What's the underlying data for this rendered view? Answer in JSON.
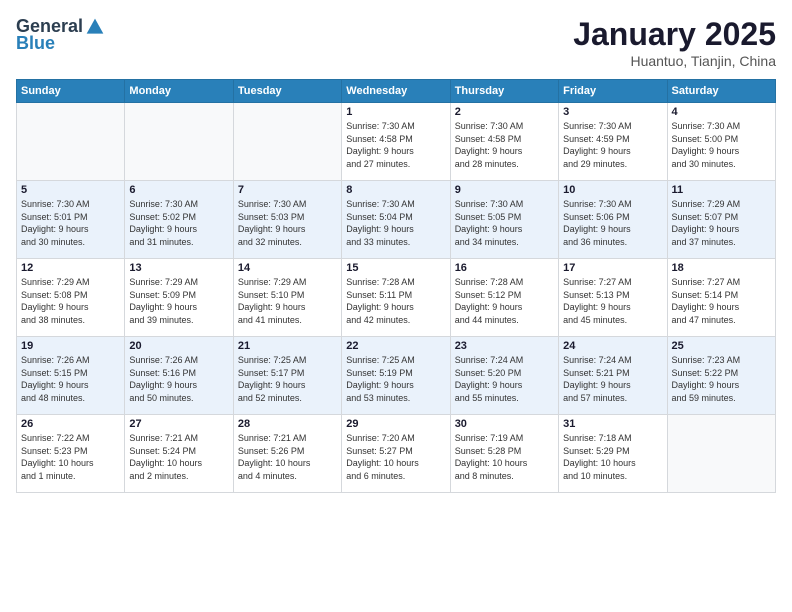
{
  "header": {
    "logo": {
      "general": "General",
      "blue": "Blue"
    },
    "title": "January 2025",
    "location": "Huantuo, Tianjin, China"
  },
  "calendar": {
    "days_of_week": [
      "Sunday",
      "Monday",
      "Tuesday",
      "Wednesday",
      "Thursday",
      "Friday",
      "Saturday"
    ],
    "weeks": [
      [
        {
          "day": "",
          "info": ""
        },
        {
          "day": "",
          "info": ""
        },
        {
          "day": "",
          "info": ""
        },
        {
          "day": "1",
          "info": "Sunrise: 7:30 AM\nSunset: 4:58 PM\nDaylight: 9 hours\nand 27 minutes."
        },
        {
          "day": "2",
          "info": "Sunrise: 7:30 AM\nSunset: 4:58 PM\nDaylight: 9 hours\nand 28 minutes."
        },
        {
          "day": "3",
          "info": "Sunrise: 7:30 AM\nSunset: 4:59 PM\nDaylight: 9 hours\nand 29 minutes."
        },
        {
          "day": "4",
          "info": "Sunrise: 7:30 AM\nSunset: 5:00 PM\nDaylight: 9 hours\nand 30 minutes."
        }
      ],
      [
        {
          "day": "5",
          "info": "Sunrise: 7:30 AM\nSunset: 5:01 PM\nDaylight: 9 hours\nand 30 minutes."
        },
        {
          "day": "6",
          "info": "Sunrise: 7:30 AM\nSunset: 5:02 PM\nDaylight: 9 hours\nand 31 minutes."
        },
        {
          "day": "7",
          "info": "Sunrise: 7:30 AM\nSunset: 5:03 PM\nDaylight: 9 hours\nand 32 minutes."
        },
        {
          "day": "8",
          "info": "Sunrise: 7:30 AM\nSunset: 5:04 PM\nDaylight: 9 hours\nand 33 minutes."
        },
        {
          "day": "9",
          "info": "Sunrise: 7:30 AM\nSunset: 5:05 PM\nDaylight: 9 hours\nand 34 minutes."
        },
        {
          "day": "10",
          "info": "Sunrise: 7:30 AM\nSunset: 5:06 PM\nDaylight: 9 hours\nand 36 minutes."
        },
        {
          "day": "11",
          "info": "Sunrise: 7:29 AM\nSunset: 5:07 PM\nDaylight: 9 hours\nand 37 minutes."
        }
      ],
      [
        {
          "day": "12",
          "info": "Sunrise: 7:29 AM\nSunset: 5:08 PM\nDaylight: 9 hours\nand 38 minutes."
        },
        {
          "day": "13",
          "info": "Sunrise: 7:29 AM\nSunset: 5:09 PM\nDaylight: 9 hours\nand 39 minutes."
        },
        {
          "day": "14",
          "info": "Sunrise: 7:29 AM\nSunset: 5:10 PM\nDaylight: 9 hours\nand 41 minutes."
        },
        {
          "day": "15",
          "info": "Sunrise: 7:28 AM\nSunset: 5:11 PM\nDaylight: 9 hours\nand 42 minutes."
        },
        {
          "day": "16",
          "info": "Sunrise: 7:28 AM\nSunset: 5:12 PM\nDaylight: 9 hours\nand 44 minutes."
        },
        {
          "day": "17",
          "info": "Sunrise: 7:27 AM\nSunset: 5:13 PM\nDaylight: 9 hours\nand 45 minutes."
        },
        {
          "day": "18",
          "info": "Sunrise: 7:27 AM\nSunset: 5:14 PM\nDaylight: 9 hours\nand 47 minutes."
        }
      ],
      [
        {
          "day": "19",
          "info": "Sunrise: 7:26 AM\nSunset: 5:15 PM\nDaylight: 9 hours\nand 48 minutes."
        },
        {
          "day": "20",
          "info": "Sunrise: 7:26 AM\nSunset: 5:16 PM\nDaylight: 9 hours\nand 50 minutes."
        },
        {
          "day": "21",
          "info": "Sunrise: 7:25 AM\nSunset: 5:17 PM\nDaylight: 9 hours\nand 52 minutes."
        },
        {
          "day": "22",
          "info": "Sunrise: 7:25 AM\nSunset: 5:19 PM\nDaylight: 9 hours\nand 53 minutes."
        },
        {
          "day": "23",
          "info": "Sunrise: 7:24 AM\nSunset: 5:20 PM\nDaylight: 9 hours\nand 55 minutes."
        },
        {
          "day": "24",
          "info": "Sunrise: 7:24 AM\nSunset: 5:21 PM\nDaylight: 9 hours\nand 57 minutes."
        },
        {
          "day": "25",
          "info": "Sunrise: 7:23 AM\nSunset: 5:22 PM\nDaylight: 9 hours\nand 59 minutes."
        }
      ],
      [
        {
          "day": "26",
          "info": "Sunrise: 7:22 AM\nSunset: 5:23 PM\nDaylight: 10 hours\nand 1 minute."
        },
        {
          "day": "27",
          "info": "Sunrise: 7:21 AM\nSunset: 5:24 PM\nDaylight: 10 hours\nand 2 minutes."
        },
        {
          "day": "28",
          "info": "Sunrise: 7:21 AM\nSunset: 5:26 PM\nDaylight: 10 hours\nand 4 minutes."
        },
        {
          "day": "29",
          "info": "Sunrise: 7:20 AM\nSunset: 5:27 PM\nDaylight: 10 hours\nand 6 minutes."
        },
        {
          "day": "30",
          "info": "Sunrise: 7:19 AM\nSunset: 5:28 PM\nDaylight: 10 hours\nand 8 minutes."
        },
        {
          "day": "31",
          "info": "Sunrise: 7:18 AM\nSunset: 5:29 PM\nDaylight: 10 hours\nand 10 minutes."
        },
        {
          "day": "",
          "info": ""
        }
      ]
    ]
  }
}
